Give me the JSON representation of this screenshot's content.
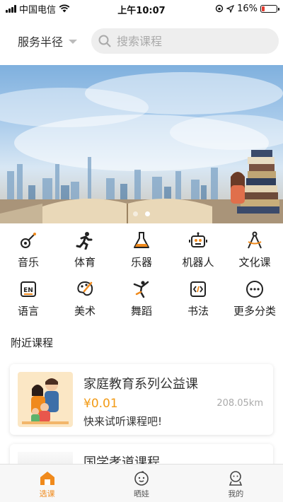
{
  "status_bar": {
    "carrier": "中国电信",
    "time": "上午10:07",
    "battery": "16%"
  },
  "header": {
    "radius_label": "服务半径",
    "search_placeholder": "搜索课程"
  },
  "banner": {
    "slide_count": 2,
    "active_slide": 2
  },
  "categories": [
    {
      "label": "音乐",
      "icon": "music-icon"
    },
    {
      "label": "体育",
      "icon": "running-icon"
    },
    {
      "label": "乐器",
      "icon": "flask-instrument-icon"
    },
    {
      "label": "机器人",
      "icon": "robot-icon"
    },
    {
      "label": "文化课",
      "icon": "compass-icon"
    },
    {
      "label": "语言",
      "icon": "en-language-icon"
    },
    {
      "label": "美术",
      "icon": "palette-icon"
    },
    {
      "label": "舞蹈",
      "icon": "dancer-icon"
    },
    {
      "label": "书法",
      "icon": "code-brush-icon"
    },
    {
      "label": "更多分类",
      "icon": "more-icon"
    }
  ],
  "nearby": {
    "title": "附近课程",
    "courses": [
      {
        "title": "家庭教育系列公益课",
        "price": "¥0.01",
        "distance": "208.05km",
        "subtitle": "快来试听课程吧!"
      },
      {
        "title": "国学孝道课程"
      }
    ]
  },
  "tabbar": {
    "items": [
      "选课",
      "晒娃",
      "我的"
    ],
    "active": "选课"
  },
  "colors": {
    "accent": "#f08a1c",
    "price": "#f29a14"
  }
}
